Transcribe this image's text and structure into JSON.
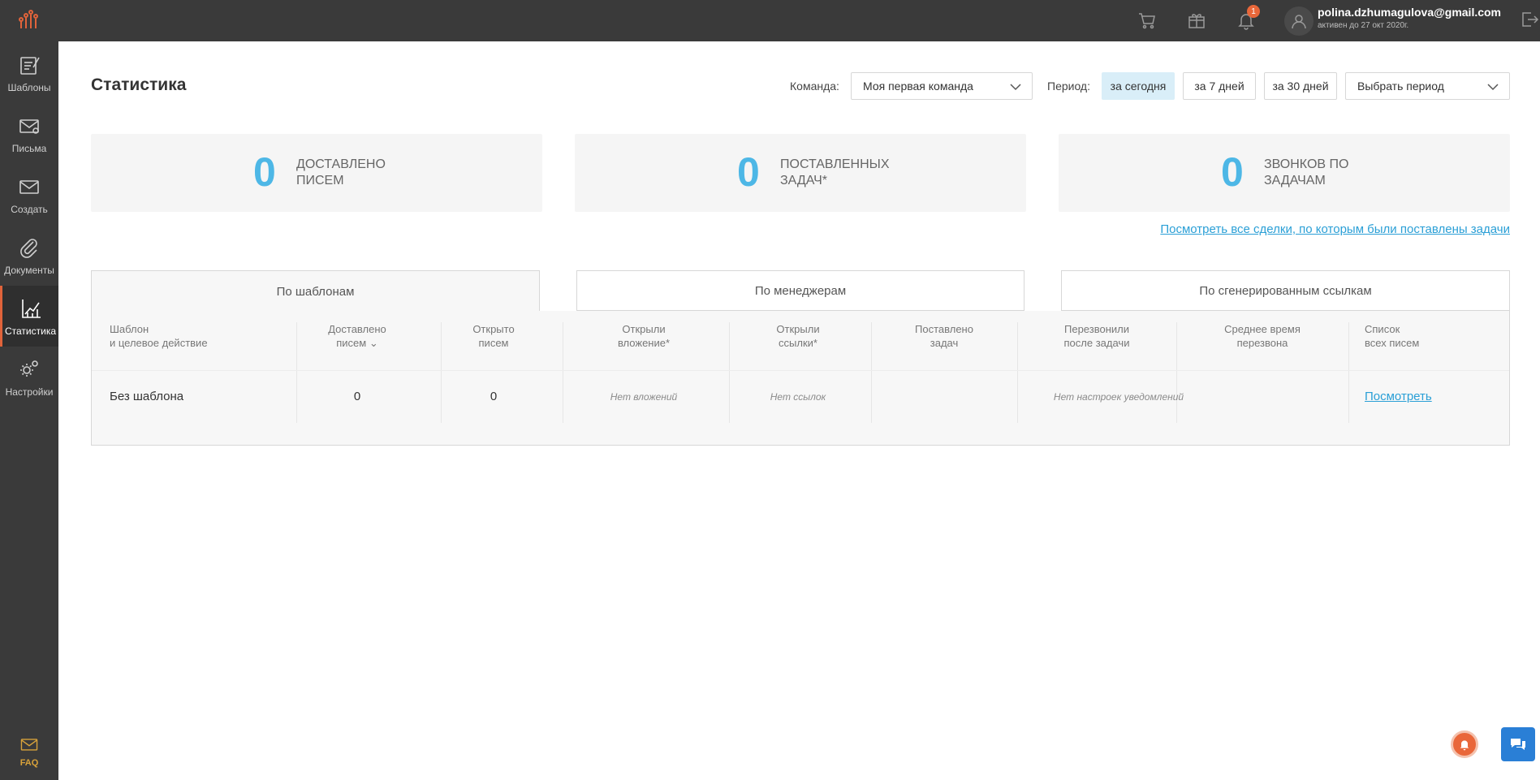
{
  "sidebar": {
    "items": [
      {
        "label": "Шаблоны",
        "icon": "templates-icon"
      },
      {
        "label": "Письма",
        "icon": "letters-icon"
      },
      {
        "label": "Создать",
        "icon": "create-icon"
      },
      {
        "label": "Документы",
        "icon": "paperclip-icon"
      },
      {
        "label": "Статистика",
        "icon": "chart-icon",
        "active": true
      },
      {
        "label": "Настройки",
        "icon": "gear-icon"
      }
    ],
    "faq_label": "FAQ"
  },
  "topbar": {
    "notification_count": "1",
    "user_email": "polina.dzhumagulova@gmail.com",
    "user_status": "активен до 27 окт 2020г."
  },
  "page": {
    "title": "Статистика"
  },
  "filters": {
    "team_label": "Команда:",
    "team_value": "Моя первая команда",
    "period_label": "Период:",
    "period_buttons": [
      "за сегодня",
      "за 7 дней",
      "за 30 дней"
    ],
    "active_period": "за сегодня",
    "custom_period": "Выбрать период"
  },
  "stats": [
    {
      "value": "0",
      "label": "доставлено писем"
    },
    {
      "value": "0",
      "label": "поставленных задач*"
    },
    {
      "value": "0",
      "label": "звонков по задачам"
    }
  ],
  "all_deals_link": "Посмотреть все сделки, по которым были поставлены задачи",
  "tabs": [
    "По шаблонам",
    "По менеджерам",
    "По сгенерированным ссылкам"
  ],
  "table": {
    "headers": [
      [
        "Шаблон",
        "и целевое действие"
      ],
      [
        "Доставлено",
        "писем"
      ],
      [
        "Открыто",
        "писем"
      ],
      [
        "Открыли",
        "вложение*"
      ],
      [
        "Открыли",
        "ссылки*"
      ],
      [
        "Поставлено",
        "задач"
      ],
      [
        "Перезвонили",
        "после задачи"
      ],
      [
        "Среднее время",
        "перезвона"
      ],
      [
        "Список",
        "всех писем"
      ]
    ],
    "row": {
      "template": "Без шаблона",
      "delivered": "0",
      "opened": "0",
      "attachments": "Нет вложений",
      "links": "Нет ссылок",
      "notifications": "Нет настроек уведомлений",
      "view_link": "Посмотреть"
    }
  },
  "colors": {
    "sidebar_bg": "#3a3a3a",
    "accent_orange": "#e0633a",
    "stat_blue": "#4db7e6",
    "link_blue": "#2a9fd6",
    "active_period_bg": "#d9eef8"
  }
}
